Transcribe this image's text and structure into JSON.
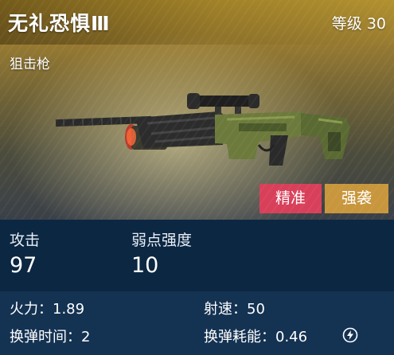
{
  "header": {
    "name": "无礼恐惧Ⅲ",
    "level": "等级 30",
    "type": "狙击枪"
  },
  "tags": {
    "precise": "精准",
    "assault": "强袭"
  },
  "stats": {
    "attack_label": "攻击",
    "attack_value": "97",
    "weakpoint_label": "弱点强度",
    "weakpoint_value": "10"
  },
  "details": {
    "firepower": "火力：1.89",
    "fire_rate": "射速：50",
    "reload_time": "换弹时间：2",
    "reload_cost": "换弹耗能：0.46"
  },
  "colors": {
    "tag_precise": "#d8405a",
    "tag_assault": "#c8963c",
    "stats_bg": "#0c2742",
    "details_bg": "#143252"
  },
  "icons": {
    "energy": "lightning-bolt-circle-icon",
    "weapon": "sniper-rifle-icon"
  }
}
